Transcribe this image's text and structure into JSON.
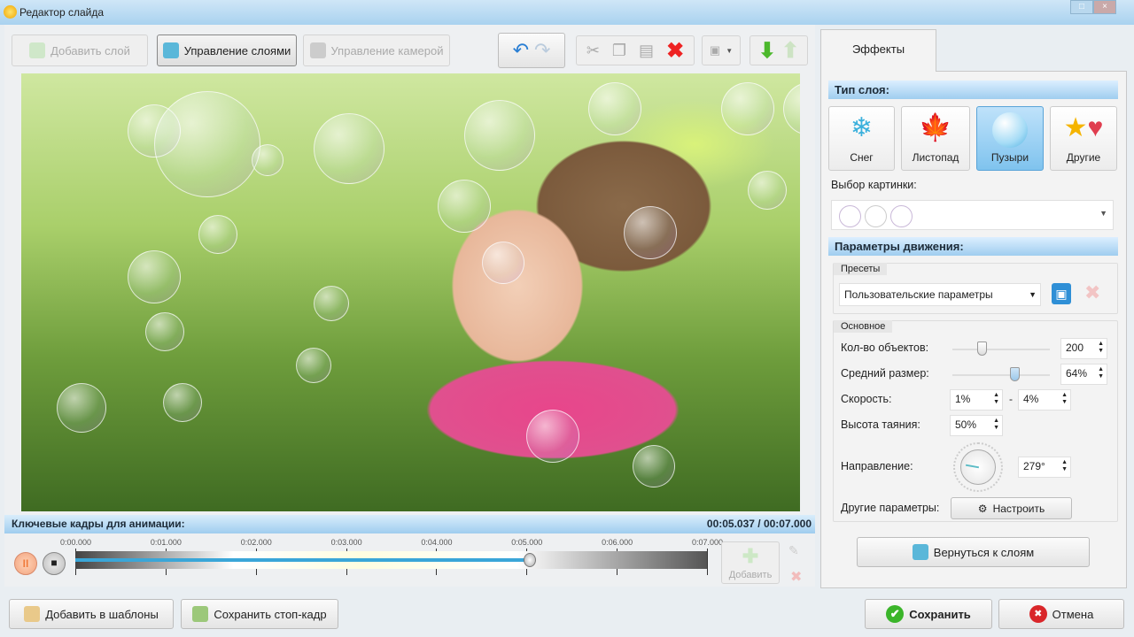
{
  "window": {
    "title": "Редактор слайда"
  },
  "toolbar": {
    "add_layer": "Добавить слой",
    "manage_layers": "Управление слоями",
    "manage_camera": "Управление камерой"
  },
  "keyframes": {
    "title": "Ключевые кадры для анимации:",
    "time": "00:05.037 / 00:07.000",
    "ticks": [
      "0:00.000",
      "0:01.000",
      "0:02.000",
      "0:03.000",
      "0:04.000",
      "0:05.000",
      "0:06.000",
      "0:07.000"
    ],
    "progress": 0.719,
    "add_label": "Добавить"
  },
  "bottom": {
    "add_template": "Добавить в шаблоны",
    "save_frame": "Сохранить стоп-кадр",
    "save": "Сохранить",
    "cancel": "Отмена"
  },
  "effects": {
    "tab": "Эффекты",
    "layer_type_title": "Тип слоя:",
    "types": [
      {
        "label": "Снег"
      },
      {
        "label": "Листопад"
      },
      {
        "label": "Пузыри"
      },
      {
        "label": "Другие"
      }
    ],
    "selected_type": "Пузыри",
    "picture_label": "Выбор картинки:",
    "motion_title": "Параметры движения:",
    "presets_label": "Пресеты",
    "preset_value": "Пользовательские параметры",
    "basic_label": "Основное",
    "count_label": "Кол-во объектов:",
    "count_value": "200",
    "count_slider": 0.3,
    "size_label": "Средний размер:",
    "size_value": "64%",
    "size_slider": 0.64,
    "speed_label": "Скорость:",
    "speed_min": "1%",
    "speed_sep": "-",
    "speed_max": "4%",
    "melt_label": "Высота таяния:",
    "melt_value": "50%",
    "direction_label": "Направление:",
    "direction_value": "279°",
    "other_label": "Другие параметры:",
    "configure": "Настроить",
    "back": "Вернуться к слоям"
  }
}
